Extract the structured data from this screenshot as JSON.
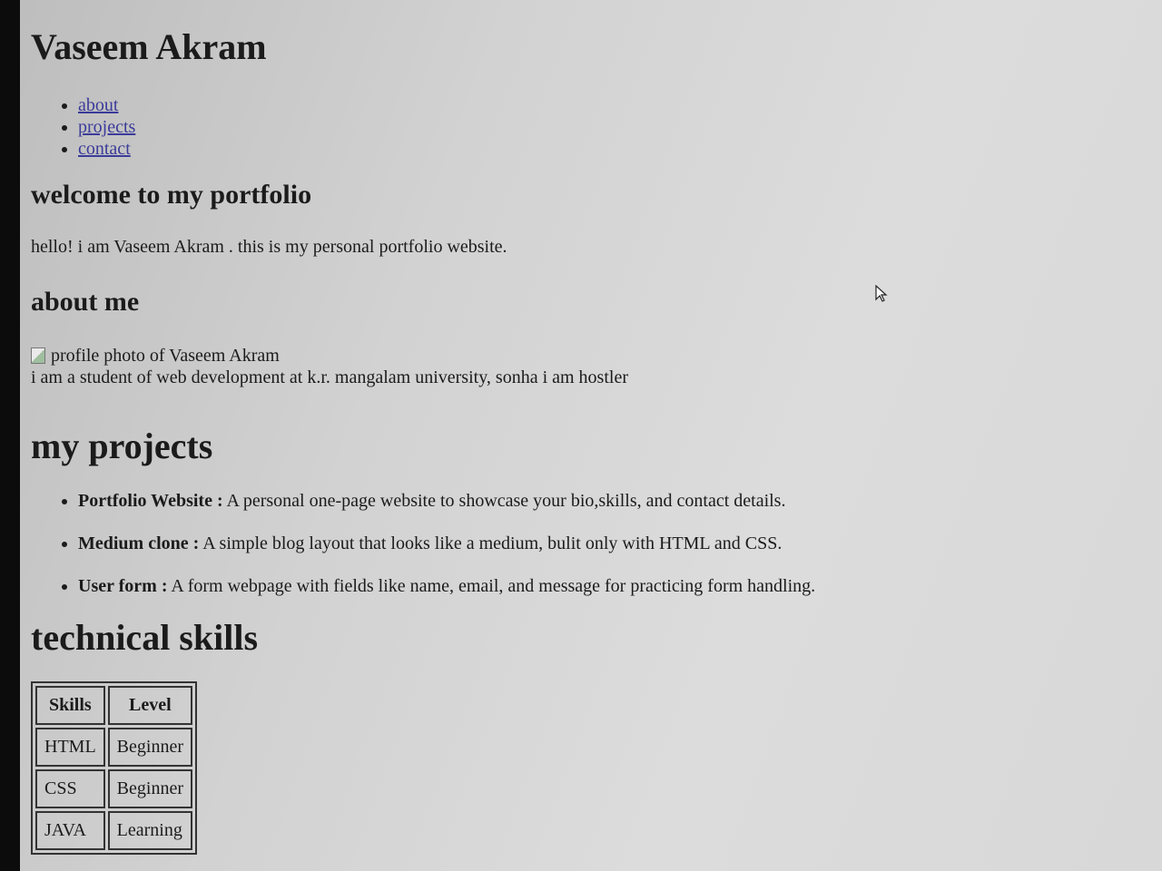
{
  "header": {
    "title": "Vaseem Akram"
  },
  "nav": {
    "items": [
      "about",
      "projects",
      "contact"
    ]
  },
  "welcome": {
    "heading": "welcome to my portfolio",
    "text": "hello! i am Vaseem Akram . this is my personal portfolio website."
  },
  "about": {
    "heading": "about me",
    "image_alt": "profile photo of Vaseem Akram",
    "text": "i am a student of web development at k.r. mangalam university, sonha i am hostler"
  },
  "projects": {
    "heading": "my projects",
    "items": [
      {
        "title": "Portfolio Website :",
        "desc": " A personal one-page website to showcase your bio,skills, and contact details."
      },
      {
        "title": "Medium clone :",
        "desc": " A simple blog layout that looks like a medium, bulit only with HTML and CSS."
      },
      {
        "title": "User form :",
        "desc": " A form webpage with fields like name, email, and message for practicing form handling."
      }
    ]
  },
  "skills": {
    "heading": "technical skills",
    "headers": [
      "Skills",
      "Level"
    ],
    "rows": [
      [
        "HTML",
        "Beginner"
      ],
      [
        "CSS",
        "Beginner"
      ],
      [
        "JAVA",
        "Learning"
      ]
    ]
  },
  "icons": {
    "cursor": "mouse-pointer-icon",
    "broken_image": "broken-image-icon"
  }
}
